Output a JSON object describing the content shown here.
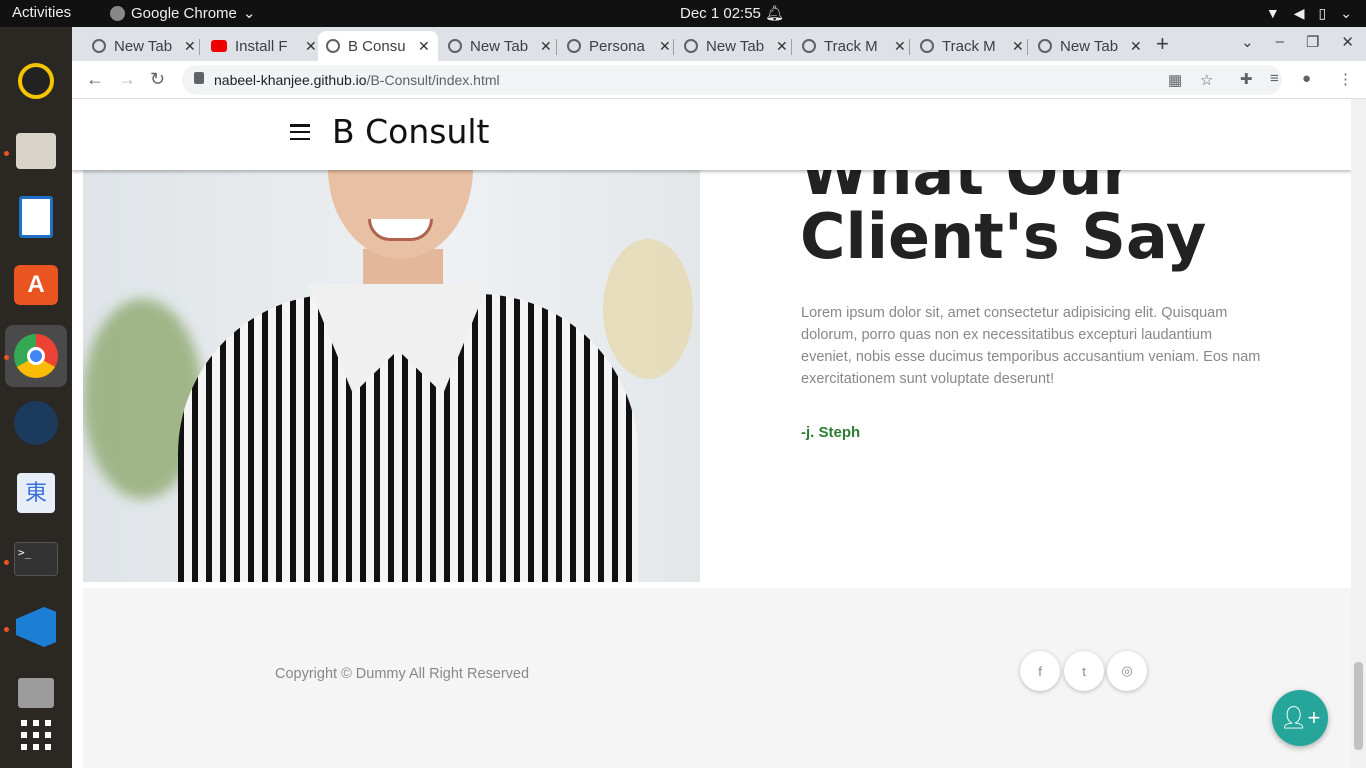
{
  "system": {
    "activities": "Activities",
    "app_name": "Google Chrome",
    "clock": "Dec 1  02:55"
  },
  "dock": {
    "items": [
      "rhythmbox-icon",
      "files-icon",
      "writer-icon",
      "software-icon",
      "chrome-icon",
      "steam-icon",
      "input-method-icon",
      "terminal-icon",
      "vscode-icon",
      "archive-icon",
      "apps-grid-icon"
    ]
  },
  "browser": {
    "tabs": [
      {
        "title": "New Tab"
      },
      {
        "title": "Install F"
      },
      {
        "title": "B Consu"
      },
      {
        "title": "New Tab"
      },
      {
        "title": "Persona"
      },
      {
        "title": "New Tab"
      },
      {
        "title": "Track M"
      },
      {
        "title": "Track M"
      },
      {
        "title": "New Tab"
      }
    ],
    "url_host": "nabeel-khanjee.github.io",
    "url_path": "/B-Consult/index.html"
  },
  "site": {
    "brand": "B Consult",
    "section_title_partial": "What Our",
    "section_title": "Client's Say",
    "quote": "Lorem ipsum dolor sit, amet consectetur adipisicing elit. Quisquam dolorum, porro quas non ex necessitatibus excepturi laudantium eveniet, nobis esse ducimus temporibus accusantium veniam. Eos nam exercitationem sunt voluptate deserunt!",
    "author": "-j. Steph",
    "copyright": "Copyright © Dummy All Right Reserved",
    "social": [
      {
        "name": "facebook",
        "glyph": "f"
      },
      {
        "name": "twitter",
        "glyph": "t"
      },
      {
        "name": "instagram",
        "glyph": "◎"
      }
    ]
  },
  "colors": {
    "author_green": "#2e7d32",
    "fab_teal": "#26a69a"
  }
}
